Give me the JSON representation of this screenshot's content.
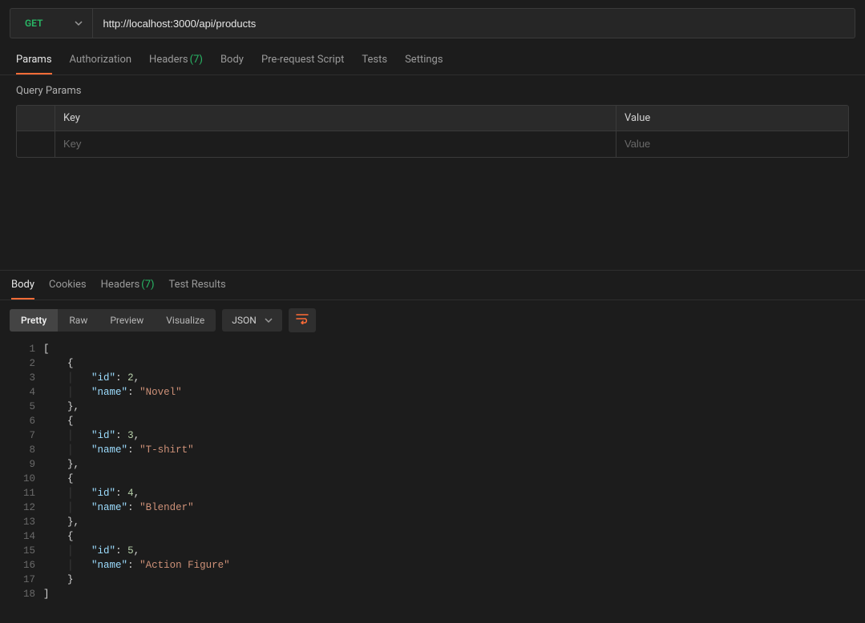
{
  "request": {
    "method": "GET",
    "url": "http://localhost:3000/api/products"
  },
  "request_tabs": [
    {
      "label": "Params",
      "active": true
    },
    {
      "label": "Authorization"
    },
    {
      "label": "Headers",
      "count": "(7)"
    },
    {
      "label": "Body"
    },
    {
      "label": "Pre-request Script"
    },
    {
      "label": "Tests"
    },
    {
      "label": "Settings"
    }
  ],
  "query_params": {
    "title": "Query Params",
    "headers": {
      "key": "Key",
      "value": "Value"
    },
    "placeholders": {
      "key": "Key",
      "value": "Value"
    }
  },
  "response_tabs": [
    {
      "label": "Body",
      "active": true
    },
    {
      "label": "Cookies"
    },
    {
      "label": "Headers",
      "count": "(7)"
    },
    {
      "label": "Test Results"
    }
  ],
  "body_view": {
    "modes": [
      "Pretty",
      "Raw",
      "Preview",
      "Visualize"
    ],
    "active_mode": "Pretty",
    "format": "JSON"
  },
  "response_json": [
    {
      "id": 2,
      "name": "Novel"
    },
    {
      "id": 3,
      "name": "T-shirt"
    },
    {
      "id": 4,
      "name": "Blender"
    },
    {
      "id": 5,
      "name": "Action Figure"
    }
  ]
}
